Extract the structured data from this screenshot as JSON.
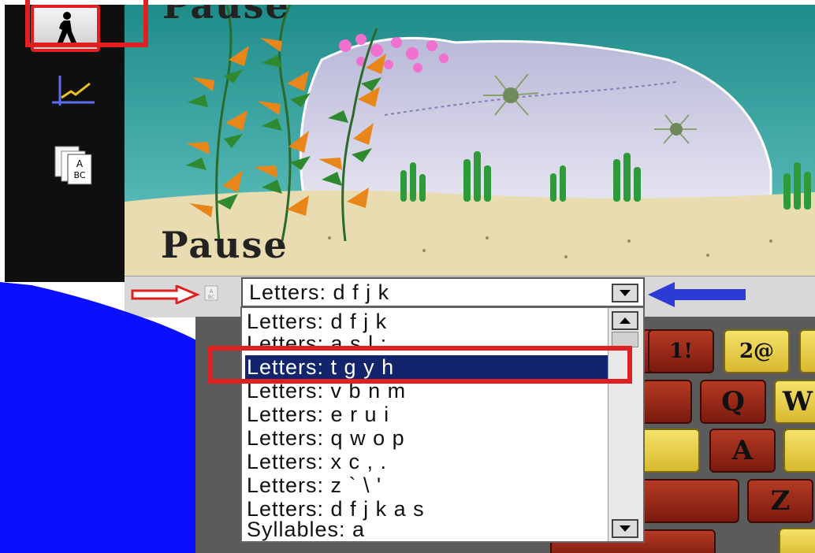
{
  "scene": {
    "pause_label": "Pause",
    "pause_label_top": "Pause"
  },
  "lesson_select": {
    "current_value": "Letters: d f j k",
    "options": [
      "Letters: d f j k",
      "Letters: a s l ;",
      "Letters: t g y h",
      "Letters: v b n m",
      "Letters: e r u i",
      "Letters: q w o p",
      "Letters: x c , .",
      "Letters: z ` \\ '",
      "Letters: d f j k a s",
      "Syllables: a"
    ],
    "selected_index": 2
  },
  "keyboard": {
    "keys": [
      "1!",
      "2@",
      "Q",
      "W",
      "A",
      "Z"
    ]
  },
  "icons": [
    "walk-icon",
    "graph-icon",
    "abc-cards-icon",
    "abc-small-icon",
    "red-arrow",
    "blue-arrow"
  ],
  "colors": {
    "highlight": "#e02020",
    "selection": "#12246b",
    "arrow_blue": "#2b3bd6",
    "water": "#0a10ff"
  }
}
